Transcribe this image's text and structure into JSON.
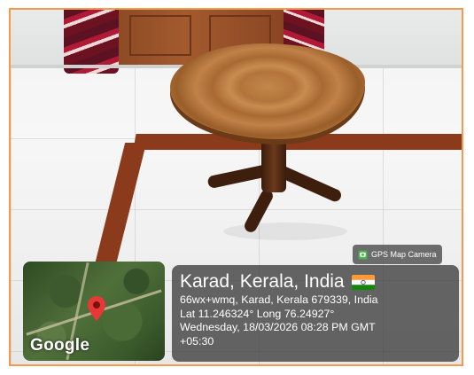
{
  "overlay": {
    "badge_label": "GPS Map Camera",
    "location_title": "Karad, Kerala, India",
    "address": "66wx+wmq, Karad, Kerala 679339, India",
    "coordinates": "Lat 11.246324° Long 76.24927°",
    "datetime": "Wednesday, 18/03/2026 08:28 PM GMT",
    "timezone": "+05:30",
    "map_logo": "Google"
  },
  "colors": {
    "frame_border": "#f39a4e",
    "overlay_bg": "#3c3c3c",
    "map_pin": "#e53935"
  },
  "icons": {
    "badge_icon": "gps-camera-icon",
    "flag": "india-flag-icon",
    "pin": "map-pin-icon"
  }
}
